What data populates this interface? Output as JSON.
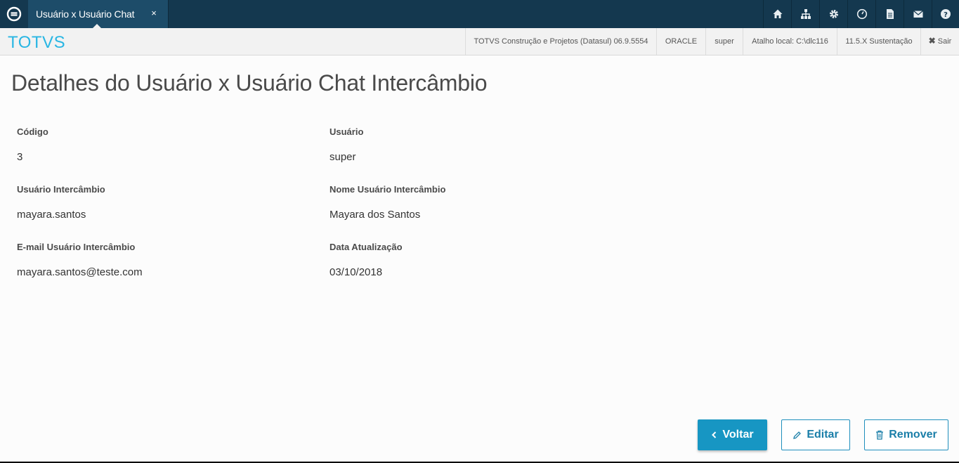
{
  "topbar": {
    "tab_label": "Usuário x Usuário Chat Intercâmbio",
    "tab_close": "×",
    "icons": [
      "home-icon",
      "sitemap-icon",
      "gear-icon",
      "clock-icon",
      "document-icon",
      "mail-icon",
      "help-icon"
    ]
  },
  "subbar": {
    "brand": "TOTVS",
    "product": "TOTVS Construção e Projetos (Datasul) 06.9.5554",
    "database": "ORACLE",
    "user": "super",
    "shortcut": "Atalho local: C:\\dlc116",
    "version": "11.5.X Sustentação",
    "logout": "Sair"
  },
  "page": {
    "title": "Detalhes do Usuário x Usuário Chat Intercâmbio"
  },
  "fields": {
    "codigo": {
      "label": "Código",
      "value": "3"
    },
    "usuario": {
      "label": "Usuário",
      "value": "super"
    },
    "usuario_intercambio": {
      "label": "Usuário Intercâmbio",
      "value": "mayara.santos"
    },
    "nome_usuario_intercambio": {
      "label": "Nome Usuário Intercâmbio",
      "value": "Mayara dos Santos"
    },
    "email_usuario_intercambio": {
      "label": "E-mail Usuário Intercâmbio",
      "value": "mayara.santos@teste.com"
    },
    "data_atualizacao": {
      "label": "Data Atualização",
      "value": "03/10/2018"
    }
  },
  "actions": {
    "back": "Voltar",
    "edit": "Editar",
    "remove": "Remover"
  },
  "colors": {
    "topbar": "#14384f",
    "tab_active": "#1d4c69",
    "brand": "#29b6e3",
    "primary": "#1796c3"
  }
}
